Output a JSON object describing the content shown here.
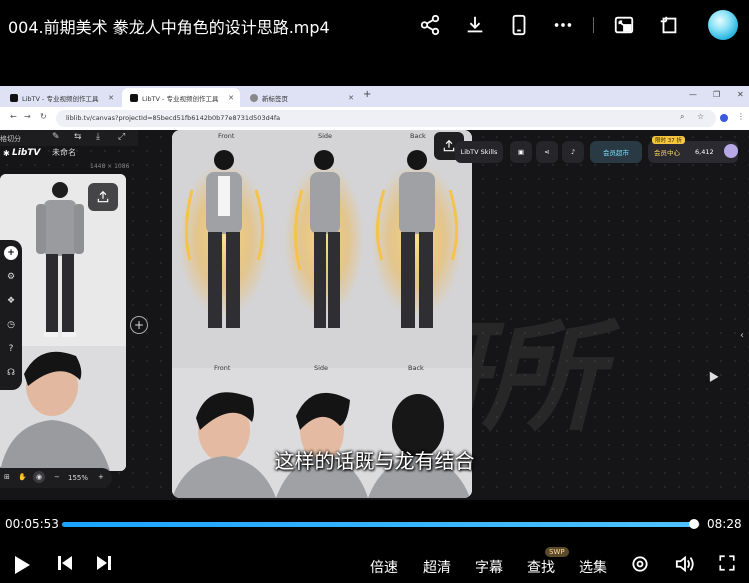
{
  "player": {
    "title": "004.前期美术 豢龙人中角色的设计思路.mp4",
    "time_current": "00:05:53",
    "time_total": "08:28",
    "progress": 0.99,
    "accent_color": "#1aa3ff",
    "subtitle": "这样的话既与龙有结合",
    "controls": {
      "speed": "倍速",
      "quality": "超清",
      "captions": "字幕",
      "search": "查找",
      "search_badge": "SWP",
      "episodes": "选集"
    }
  },
  "browser": {
    "tabs": [
      {
        "label": "LibTV - 专业视频创作工具"
      },
      {
        "label": "LibTV - 专业视频创作工具"
      },
      {
        "label": "新标签页"
      }
    ],
    "new_tab": "+",
    "url": "liblib.tv/canvas?projectId=85becd51fb6142b0b77e8731d503d4fa"
  },
  "app": {
    "toolbar_label": "格切分",
    "brand": "LibTV",
    "doc_name": "未命名",
    "left_dims": "1448 × 1086",
    "zoom": "155%",
    "views_top": [
      "Front",
      "Side",
      "Back"
    ],
    "views_bottom": [
      "Front",
      "Side",
      "Back"
    ],
    "header": {
      "skills": "LibTV Skills",
      "vip_market": "会员超市",
      "vip_center": "会员中心",
      "limited_badge": "限时 37 折",
      "points": "6,412"
    }
  }
}
